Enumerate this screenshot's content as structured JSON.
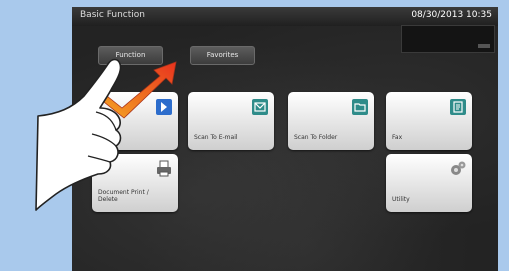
{
  "header": {
    "title": "Basic Function",
    "datetime": "08/30/2013 10:35"
  },
  "tabs": [
    {
      "label": "Function"
    },
    {
      "label": "Favorites"
    }
  ],
  "tiles": {
    "copy": "Copy",
    "scan_email": "Scan To E-mail",
    "scan_folder": "Scan To Folder",
    "fax": "Fax",
    "document": "Document Print / Delete",
    "utility": "Utility"
  },
  "colors": {
    "arrow_gradient": [
      "#f5a623",
      "#e8321e"
    ],
    "icon_blue": "#2d6dcc",
    "icon_teal": "#2f8c8a"
  }
}
